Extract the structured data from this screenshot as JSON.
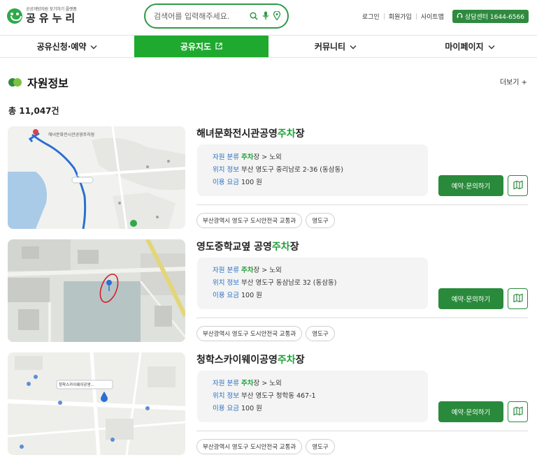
{
  "header": {
    "logo_sub": "공공개방자원 포기하기 플랫폼",
    "logo_main": "공유누리",
    "search_placeholder": "검색어를 입력해주세요.",
    "links": [
      "로그인",
      "회원가입",
      "사이트맵"
    ],
    "callcenter": "상담센터 1644-6566"
  },
  "nav": [
    {
      "label": "공유신청·예약",
      "icon": "chevron-down-icon"
    },
    {
      "label": "공유지도",
      "icon": "external-link-icon",
      "active": true
    },
    {
      "label": "커뮤니티",
      "icon": "chevron-down-icon"
    },
    {
      "label": "마이페이지",
      "icon": "chevron-down-icon"
    }
  ],
  "section": {
    "title": "자원정보",
    "more": "더보기 +",
    "total": "총 11,047건"
  },
  "labels": {
    "category": "자원 분류",
    "location": "위치 정보",
    "fee": "이용 요금",
    "reserve": "예약·문의하기"
  },
  "cards": [
    {
      "title_pre": "해녀문화전시관공영",
      "title_hl": "주차",
      "title_post": "장",
      "category_hl": "주차",
      "category_rest": "장 > 노외",
      "location": "부산 영도구 중리남로 2-36 (동삼동)",
      "fee": "100 원",
      "tags": [
        "부산광역시 영도구 도시안전국 교통과",
        "영도구"
      ],
      "map_label": "해녀문화전시관공영주차장"
    },
    {
      "title_pre": "영도중학교옆 공영",
      "title_hl": "주차",
      "title_post": "장",
      "category_hl": "주차",
      "category_rest": "장 > 노외",
      "location": "부산 영도구 동삼남로 32 (동삼동)",
      "fee": "100 원",
      "tags": [
        "부산광역시 영도구 도시안전국 교통과",
        "영도구"
      ]
    },
    {
      "title_pre": "청학스카이웨이공영",
      "title_hl": "주차",
      "title_post": "장",
      "category_hl": "주차",
      "category_rest": "장 > 노외",
      "location": "부산 영도구 청학동 467-1",
      "fee": "100 원",
      "tags": [
        "부산광역시 영도구 도시안전국 교통과",
        "영도구"
      ],
      "map_label": "청학스카이웨이공영..."
    }
  ],
  "colors": {
    "brand_green": "#2a8a3b",
    "nav_active": "#1faa2f",
    "highlight": "#22a03a",
    "label_blue": "#2b6fc4"
  }
}
